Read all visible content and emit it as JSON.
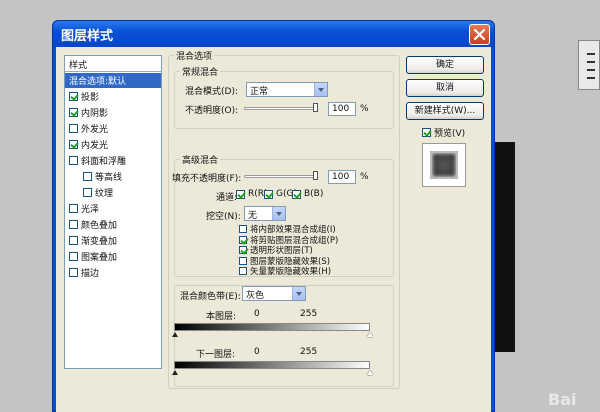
{
  "title": "图层样式",
  "styles": {
    "header": "样式",
    "items": [
      {
        "label": "混合选项:默认",
        "checkbox": false,
        "checked": false,
        "selected": true,
        "indent": false
      },
      {
        "label": "投影",
        "checkbox": true,
        "checked": true,
        "selected": false,
        "indent": false
      },
      {
        "label": "内阴影",
        "checkbox": true,
        "checked": true,
        "selected": false,
        "indent": false
      },
      {
        "label": "外发光",
        "checkbox": true,
        "checked": false,
        "selected": false,
        "indent": false
      },
      {
        "label": "内发光",
        "checkbox": true,
        "checked": true,
        "selected": false,
        "indent": false
      },
      {
        "label": "斜面和浮雕",
        "checkbox": true,
        "checked": false,
        "selected": false,
        "indent": false
      },
      {
        "label": "等高线",
        "checkbox": true,
        "checked": false,
        "selected": false,
        "indent": true
      },
      {
        "label": "纹理",
        "checkbox": true,
        "checked": false,
        "selected": false,
        "indent": true
      },
      {
        "label": "光泽",
        "checkbox": true,
        "checked": false,
        "selected": false,
        "indent": false
      },
      {
        "label": "颜色叠加",
        "checkbox": true,
        "checked": false,
        "selected": false,
        "indent": false
      },
      {
        "label": "渐变叠加",
        "checkbox": true,
        "checked": false,
        "selected": false,
        "indent": false
      },
      {
        "label": "图案叠加",
        "checkbox": true,
        "checked": false,
        "selected": false,
        "indent": false
      },
      {
        "label": "描边",
        "checkbox": true,
        "checked": false,
        "selected": false,
        "indent": false
      }
    ]
  },
  "blend": {
    "section_title": "混合选项",
    "general": {
      "title": "常规混合",
      "mode_label": "混合模式(D):",
      "mode_value": "正常",
      "opacity_label": "不透明度(O):",
      "opacity_value": "100",
      "opacity_level": 1.0,
      "percent": "%"
    },
    "advanced": {
      "title": "高级混合",
      "fill_label": "填充不透明度(F):",
      "fill_value": "100",
      "fill_level": 1.0,
      "percent": "%",
      "channels_label": "通道:",
      "channels": [
        {
          "label": "R(R)",
          "checked": true
        },
        {
          "label": "G(G)",
          "checked": true
        },
        {
          "label": "B(B)",
          "checked": true
        }
      ],
      "knockout_label": "挖空(N):",
      "knockout_value": "无",
      "options": [
        {
          "label": "将内部效果混合成组(I)",
          "checked": false
        },
        {
          "label": "将剪贴图层混合成组(P)",
          "checked": true
        },
        {
          "label": "透明形状图层(T)",
          "checked": true
        },
        {
          "label": "图层蒙版隐藏效果(S)",
          "checked": false
        },
        {
          "label": "矢量蒙版隐藏效果(H)",
          "checked": false
        }
      ]
    },
    "blend_if": {
      "label": "混合颜色带(E):",
      "value": "灰色",
      "this_layer": {
        "label": "本图层:",
        "min": "0",
        "max": "255"
      },
      "underlying": {
        "label": "下一图层:",
        "min": "0",
        "max": "255"
      }
    }
  },
  "buttons": {
    "ok": "确定",
    "cancel": "取消",
    "new_style": "新建样式(W)...",
    "preview_label": "预览(V)",
    "preview_checked": true
  },
  "watermark": "Bai"
}
